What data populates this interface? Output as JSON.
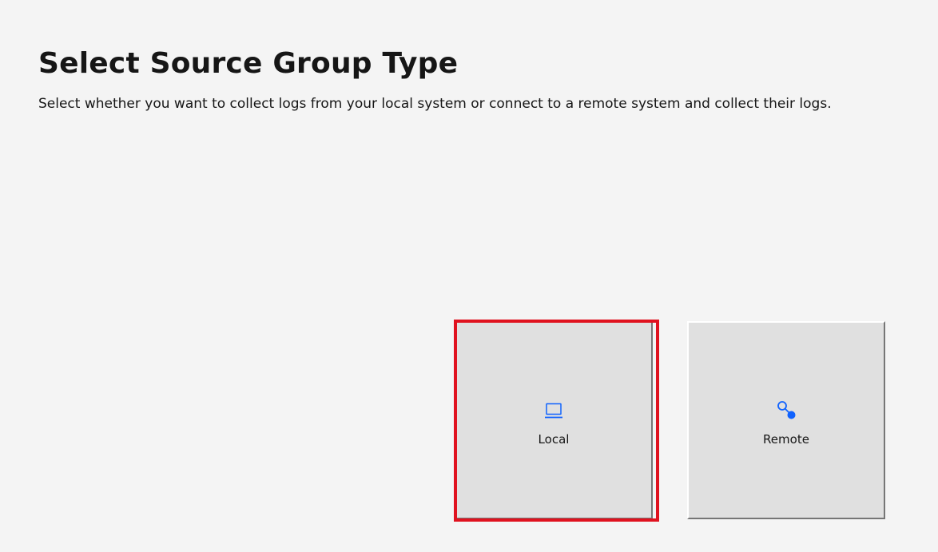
{
  "page": {
    "title": "Select Source Group Type",
    "description": "Select whether you want to collect logs from your local system or connect to a remote system and collect their logs."
  },
  "options": [
    {
      "label": "Local",
      "icon": "laptop-icon",
      "selected": true
    },
    {
      "label": "Remote",
      "icon": "remote-connection-icon",
      "selected": false
    }
  ],
  "colors": {
    "background": "#f4f4f4",
    "tile": "#e0e0e0",
    "icon_accent": "#0f62fe",
    "highlight": "#e0121f",
    "text": "#161616"
  }
}
